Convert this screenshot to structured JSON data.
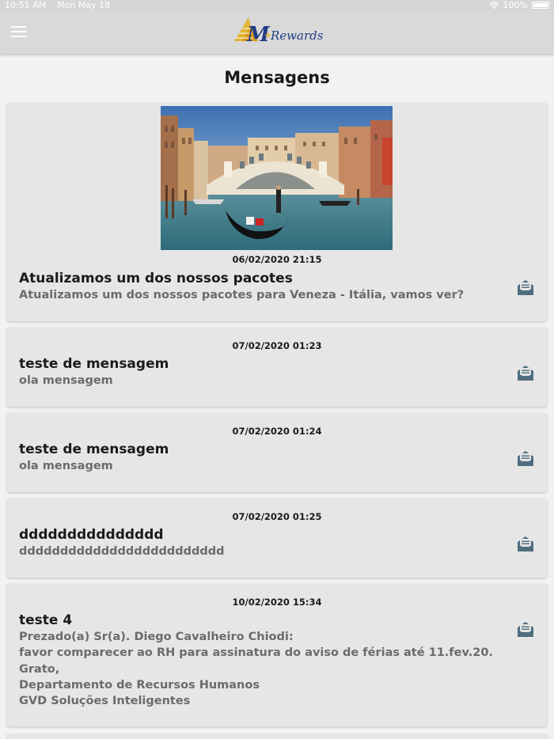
{
  "status_bar": {
    "time": "10:51 AM",
    "date": "Mon May 18",
    "battery": "100%"
  },
  "header": {
    "logo_text": "M+Rewards",
    "menu_icon": "hamburger-icon"
  },
  "page": {
    "title": "Mensagens"
  },
  "messages": [
    {
      "date": "06/02/2020 21:15",
      "title": "Atualizamos um dos nossos pacotes",
      "body": [
        "Atualizamos um dos nossos pacotes para Veneza - Itália, vamos ver?"
      ],
      "has_image": true,
      "icon": "open-envelope-icon"
    },
    {
      "date": "07/02/2020 01:23",
      "title": "teste de mensagem",
      "body": [
        "ola mensagem"
      ],
      "icon": "open-envelope-icon"
    },
    {
      "date": "07/02/2020 01:24",
      "title": "teste de mensagem",
      "body": [
        "ola mensagem"
      ],
      "icon": "open-envelope-icon"
    },
    {
      "date": "07/02/2020 01:25",
      "title": "ddddddddddddddd",
      "body": [
        "ddddddddddddddddddddddddd"
      ],
      "icon": "open-envelope-icon"
    },
    {
      "date": "10/02/2020 15:34",
      "title": "teste 4",
      "body": [
        "Prezado(a) Sr(a). Diego Cavalheiro Chiodi:",
        "favor comparecer ao RH para assinatura do aviso de férias até 11.fev.20.",
        "Grato,",
        "Departamento de Recursos Humanos",
        "GVD Soluções Inteligentes"
      ],
      "icon": "open-envelope-icon"
    }
  ],
  "colors": {
    "nav_bg": "#d9d9d9",
    "card_bg": "#e6e6e6",
    "icon_color": "#4f6d7e",
    "logo_blue": "#1f3c85",
    "logo_gold": "#e2b12c"
  }
}
